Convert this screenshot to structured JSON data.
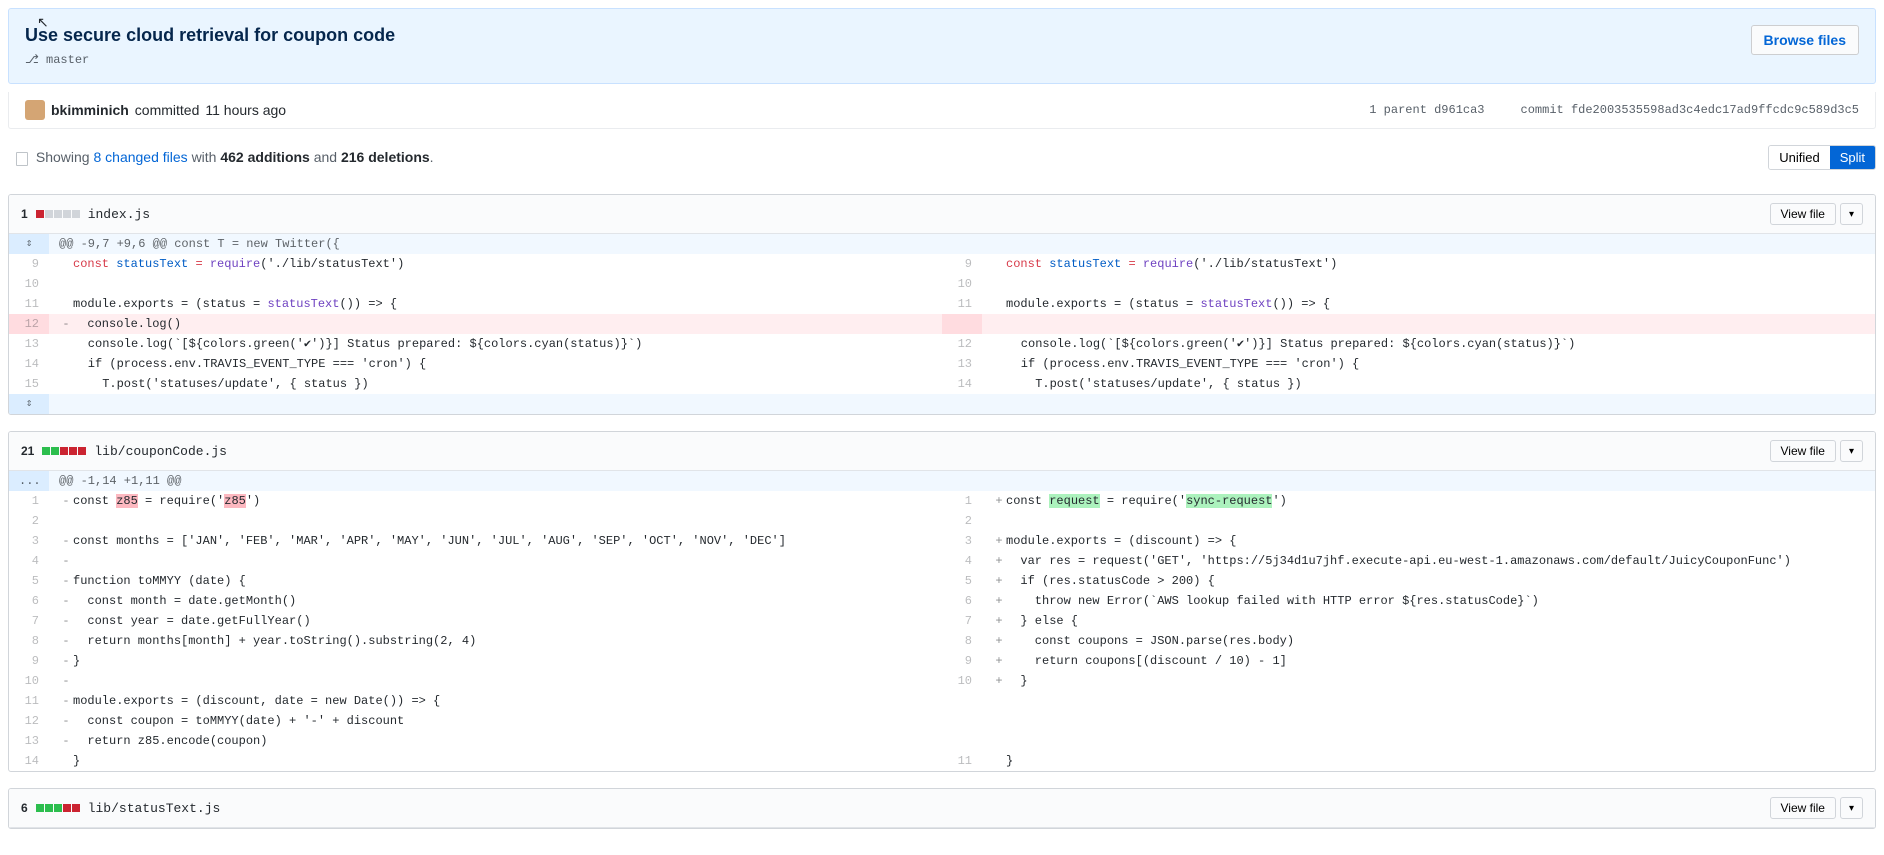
{
  "cursor": "↖",
  "commit": {
    "title": "Use secure cloud retrieval for coupon code",
    "branch_icon": "⎇",
    "branch": "master",
    "browse_files": "Browse files",
    "author": "bkimminich",
    "committed": "committed",
    "time": "11 hours ago",
    "parent_label": "1 parent",
    "parent_sha": "d961ca3",
    "commit_label": "commit",
    "full_sha": "fde2003535598ad3c4edc17ad9ffcdc9c589d3c5"
  },
  "toolbar": {
    "showing": "Showing",
    "changed_files": "8 changed files",
    "with": "with",
    "additions": "462 additions",
    "and": "and",
    "deletions": "216 deletions",
    "period": ".",
    "unified": "Unified",
    "split": "Split"
  },
  "file1": {
    "count": "1",
    "name": "index.js",
    "view_file": "View file",
    "caret": "▾",
    "hunk": "@@ -9,7 +9,6 @@ const T = new Twitter({",
    "expand": "⇕",
    "l9": "const",
    "l9_var": " statusText ",
    "l9_eq": "= ",
    "l9_fn": "require",
    "l9_rest": "('./lib/statusText')",
    "l11": "module.exports = (status = ",
    "l11_fn": "statusText",
    "l11_rest": "()) => {",
    "l12": "  console.log()",
    "l_cons": "    console.log(`[${colors.green('✔')}] Status prepared: ${colors.cyan(status)}`)",
    "l_if": "    if (process.env.TRAVIS_EVENT_TYPE === 'cron') {",
    "l_post": "      T.post('statuses/update', { status })",
    "ln_l9": "9",
    "ln_l10": "10",
    "ln_l11": "11",
    "ln_l12": "12",
    "ln_l13": "13",
    "ln_l14": "14",
    "ln_l15": "15",
    "ln_r9": "9",
    "ln_r10": "10",
    "ln_r11": "11",
    "ln_r12": "12",
    "ln_r13": "13",
    "ln_r14": "14"
  },
  "file2": {
    "count": "21",
    "name": "lib/couponCode.js",
    "view_file": "View file",
    "caret": "▾",
    "dots": "...",
    "hunk": "@@ -1,14 +1,11 @@",
    "ln_l1": "1",
    "ln_l2": "2",
    "ln_l3": "3",
    "ln_l4": "4",
    "ln_l5": "5",
    "ln_l6": "6",
    "ln_l7": "7",
    "ln_l8": "8",
    "ln_l9": "9",
    "ln_l10": "10",
    "ln_l11": "11",
    "ln_l12": "12",
    "ln_l13": "13",
    "ln_l14": "14",
    "ln_r1": "1",
    "ln_r2": "2",
    "ln_r3": "3",
    "ln_r4": "4",
    "ln_r5": "5",
    "ln_r6": "6",
    "ln_r7": "7",
    "ln_r8": "8",
    "ln_r9": "9",
    "ln_r10": "10",
    "ln_r11": "11",
    "l1_a": "const ",
    "l1_hl1": "z85",
    "l1_b": " = require('",
    "l1_hl2": "z85",
    "l1_c": "')",
    "r1_a": "const ",
    "r1_hl1": "request",
    "r1_b": " = require('",
    "r1_hl2": "sync-request",
    "r1_c": "')",
    "l3": "const months = ['JAN', 'FEB', 'MAR', 'APR', 'MAY', 'JUN', 'JUL', 'AUG', 'SEP', 'OCT', 'NOV', 'DEC']",
    "l5": "function toMMYY (date) {",
    "l6": "  const month = date.getMonth()",
    "l7": "  const year = date.getFullYear()",
    "l8": "  return months[month] + year.toString().substring(2, 4)",
    "l9": "}",
    "l11": "module.exports = (discount, date = new Date()) => {",
    "l12": "  const coupon = toMMYY(date) + '-' + discount",
    "l13": "  return z85.encode(coupon)",
    "r3": "module.exports = (discount) => {",
    "r4": "  var res = request('GET', 'https://5j34d1u7jhf.execute-api.eu-west-1.amazonaws.com/default/JuicyCouponFunc')",
    "r5": "  if (res.statusCode > 200) {",
    "r6": "    throw new Error(`AWS lookup failed with HTTP error ${res.statusCode}`)",
    "r7": "  } else {",
    "r8": "    const coupons = JSON.parse(res.body)",
    "r9": "    return coupons[(discount / 10) - 1]",
    "r10": "  }",
    "brace": "}"
  },
  "file3": {
    "count": "6",
    "name": "lib/statusText.js",
    "view_file": "View file"
  }
}
